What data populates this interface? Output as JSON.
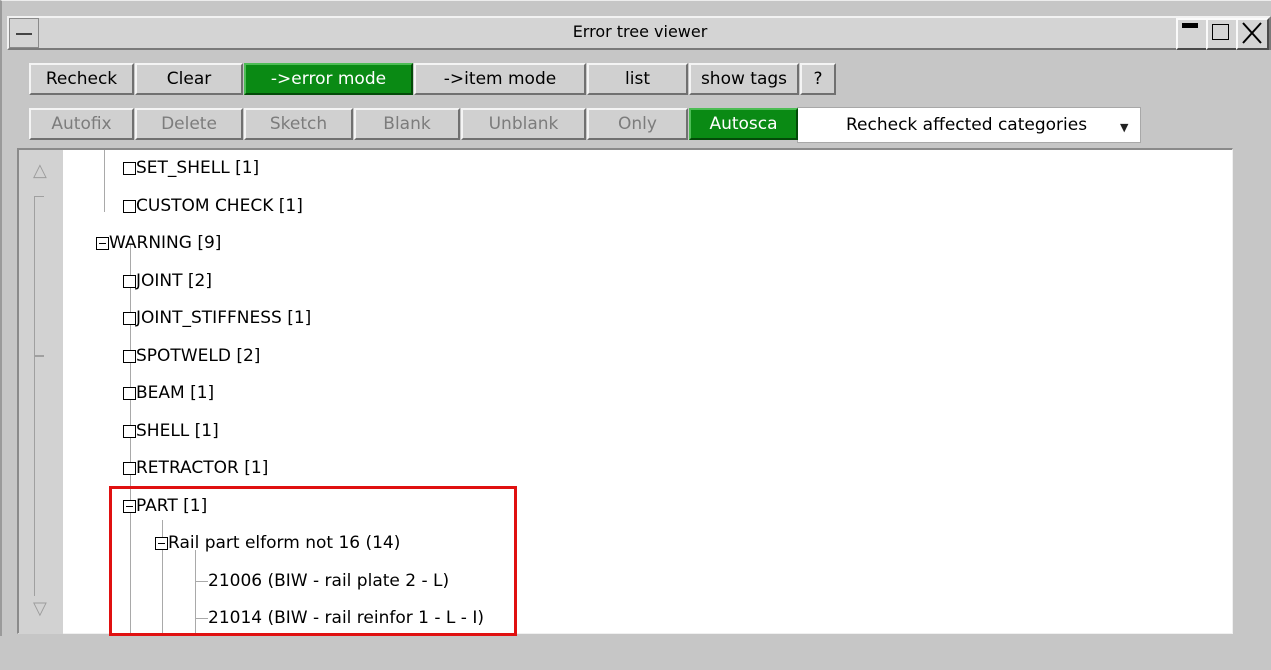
{
  "window": {
    "title": "Error tree viewer",
    "controls": [
      "minimize",
      "maximize",
      "close"
    ]
  },
  "toolbar1": {
    "buttons": [
      {
        "label": "Recheck",
        "active": false
      },
      {
        "label": "Clear",
        "active": false
      },
      {
        "label": "->error mode",
        "active": true
      },
      {
        "label": "->item mode",
        "active": false
      },
      {
        "label": "list",
        "active": false
      },
      {
        "label": "show tags",
        "active": false
      },
      {
        "label": "?",
        "active": false
      }
    ]
  },
  "toolbar2": {
    "buttons": [
      {
        "label": "Autofix",
        "enabled": false
      },
      {
        "label": "Delete",
        "enabled": false
      },
      {
        "label": "Sketch",
        "enabled": false
      },
      {
        "label": "Blank",
        "enabled": false
      },
      {
        "label": "Unblank",
        "enabled": false
      },
      {
        "label": "Only",
        "enabled": false
      },
      {
        "label": "Autosca",
        "enabled": true,
        "active": true
      }
    ],
    "dropdown": {
      "selected": "Recheck affected categories",
      "arrow_icon": "dropdown-arrow-icon"
    }
  },
  "tree": {
    "rows": [
      {
        "label": "SET_SHELL [1]",
        "level": 2,
        "expander": "box"
      },
      {
        "label": "CUSTOM CHECK [1]",
        "level": 2,
        "expander": "box"
      },
      {
        "label": "WARNING [9]",
        "level": 1,
        "expander": "minus"
      },
      {
        "label": "JOINT [2]",
        "level": 2,
        "expander": "box"
      },
      {
        "label": "JOINT_STIFFNESS [1]",
        "level": 2,
        "expander": "box"
      },
      {
        "label": "SPOTWELD [2]",
        "level": 2,
        "expander": "box"
      },
      {
        "label": "BEAM [1]",
        "level": 2,
        "expander": "box"
      },
      {
        "label": "SHELL [1]",
        "level": 2,
        "expander": "box"
      },
      {
        "label": "RETRACTOR [1]",
        "level": 2,
        "expander": "box"
      },
      {
        "label": "PART [1]",
        "level": 2,
        "expander": "minus"
      },
      {
        "label": "Rail part elform not 16 (14)",
        "level": 3,
        "expander": "minus"
      },
      {
        "label": "21006 (BIW - rail plate 2 - L)",
        "level": 4,
        "expander": "none"
      },
      {
        "label": "21014 (BIW - rail reinfor 1 - L - I)",
        "level": 4,
        "expander": "none"
      }
    ],
    "highlight_color": "#e01010"
  },
  "colors": {
    "panel_bg": "#c6c6c6",
    "active_green": "#0a8a14",
    "tree_bg": "#ffffff"
  }
}
